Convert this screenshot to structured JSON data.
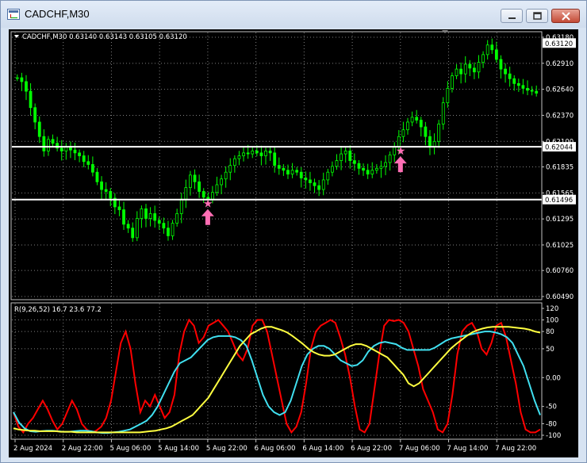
{
  "window": {
    "title": "CADCHF,M30",
    "buttons": [
      "minimize",
      "maximize",
      "close"
    ]
  },
  "colors": {
    "background": "#000000",
    "candles": "#00ff00",
    "level_lines": "#ffffff",
    "signal_marker": "#ff6eb4",
    "rvi_red": "#ff0000",
    "rvi_cyan": "#40e0f0",
    "rvi_yellow": "#ffff40",
    "grid": "#808080"
  },
  "icons": [
    "window-app-icon",
    "minimize-icon",
    "maximize-icon",
    "close-icon",
    "star-marker-icon",
    "arrow-up-icon"
  ],
  "chart_data": [
    {
      "type": "candlestick",
      "header": "CADCHF,M30  0.63140 0.63143 0.63105 0.63120",
      "symbol": "CADCHF",
      "timeframe": "M30",
      "ohlc_current": {
        "open": "0.63140",
        "high": "0.63143",
        "low": "0.63105",
        "close": "0.63120"
      },
      "y_ticks": [
        "0.63180",
        "0.62910",
        "0.62640",
        "0.62370",
        "0.62100",
        "0.61835",
        "0.61565",
        "0.61295",
        "0.61025",
        "0.60760",
        "0.60490"
      ],
      "ylim": [
        0.6049,
        0.6318
      ],
      "price_tag": "0.63120",
      "levels": [
        {
          "value": 0.62044,
          "label": "0.62044"
        },
        {
          "value": 0.61496,
          "label": "0.61496"
        }
      ],
      "closes": [
        0.6276,
        0.6272,
        0.6262,
        0.6245,
        0.623,
        0.6215,
        0.62,
        0.6212,
        0.6208,
        0.6203,
        0.62,
        0.6204,
        0.6201,
        0.6198,
        0.6195,
        0.6189,
        0.6186,
        0.6178,
        0.6168,
        0.616,
        0.6158,
        0.6151,
        0.6142,
        0.6139,
        0.6124,
        0.612,
        0.611,
        0.613,
        0.614,
        0.613,
        0.6135,
        0.6128,
        0.6125,
        0.612,
        0.6112,
        0.6125,
        0.6135,
        0.615,
        0.6162,
        0.6175,
        0.6168,
        0.6158,
        0.6152,
        0.615,
        0.6157,
        0.6165,
        0.6171,
        0.6178,
        0.6185,
        0.6192,
        0.6195,
        0.6198,
        0.6197,
        0.62,
        0.6198,
        0.6195,
        0.62,
        0.6198,
        0.6185,
        0.6182,
        0.618,
        0.6176,
        0.618,
        0.6178,
        0.6172,
        0.617,
        0.6167,
        0.6164,
        0.616,
        0.617,
        0.6178,
        0.6184,
        0.619,
        0.6197,
        0.62,
        0.619,
        0.6187,
        0.6182,
        0.618,
        0.6176,
        0.618,
        0.6182,
        0.6184,
        0.6188,
        0.6196,
        0.6204,
        0.6215,
        0.6222,
        0.623,
        0.6235,
        0.6232,
        0.6225,
        0.6215,
        0.6204,
        0.621,
        0.6228,
        0.625,
        0.6265,
        0.6278,
        0.6285,
        0.628,
        0.629,
        0.6286,
        0.6282,
        0.6292,
        0.63,
        0.631,
        0.6305,
        0.6295,
        0.6285,
        0.628,
        0.6275,
        0.627,
        0.6268,
        0.6265,
        0.6263,
        0.6262,
        0.626
      ],
      "signals": [
        {
          "time": "5 Aug 22:00",
          "type": "buy",
          "price": 0.61496
        },
        {
          "time": "7 Aug 06:00",
          "type": "buy",
          "price": 0.62044
        }
      ]
    },
    {
      "type": "line",
      "header": "R(9,26,52) 16.7 23.6 77.2",
      "indicator": "R(9,26,52)",
      "current_values": [
        "16.7",
        "23.6",
        "77.2"
      ],
      "y_ticks": [
        "120",
        "100",
        "80",
        "50",
        "0.00",
        "-50",
        "-80",
        "-100"
      ],
      "ylim": [
        -100,
        120
      ],
      "x_labels": [
        "2 Aug 2024",
        "2 Aug 22:00",
        "5 Aug 06:00",
        "5 Aug 14:00",
        "5 Aug 22:00",
        "6 Aug 06:00",
        "6 Aug 14:00",
        "6 Aug 22:00",
        "7 Aug 06:00",
        "7 Aug 14:00",
        "7 Aug 22:00"
      ],
      "series": [
        {
          "color": "#ff0000",
          "values": [
            -60,
            -85,
            -95,
            -80,
            -70,
            -55,
            -40,
            -55,
            -75,
            -90,
            -80,
            -60,
            -40,
            -55,
            -80,
            -90,
            -95,
            -92,
            -85,
            -70,
            -40,
            10,
            60,
            80,
            50,
            -10,
            -60,
            -40,
            -50,
            -30,
            -50,
            -70,
            -60,
            -30,
            40,
            80,
            100,
            90,
            60,
            70,
            90,
            95,
            100,
            90,
            80,
            60,
            40,
            30,
            50,
            90,
            100,
            100,
            80,
            40,
            0,
            -40,
            -80,
            -95,
            -85,
            -60,
            -10,
            50,
            80,
            90,
            95,
            100,
            95,
            70,
            40,
            0,
            -50,
            -90,
            -95,
            -80,
            -20,
            40,
            90,
            100,
            98,
            100,
            95,
            80,
            50,
            20,
            -20,
            -40,
            -60,
            -90,
            -95,
            -80,
            -30,
            40,
            80,
            90,
            95,
            80,
            50,
            40,
            60,
            90,
            95,
            70,
            30,
            -10,
            -60,
            -90,
            -95,
            -95,
            -90
          ]
        },
        {
          "color": "#40e0f0",
          "values": [
            -60,
            -78,
            -88,
            -93,
            -94,
            -93,
            -92,
            -92,
            -93,
            -94,
            -94,
            -93,
            -92,
            -92,
            -93,
            -95,
            -96,
            -96,
            -95,
            -94,
            -92,
            -90,
            -85,
            -80,
            -75,
            -65,
            -50,
            -30,
            -10,
            10,
            25,
            30,
            35,
            45,
            55,
            65,
            70,
            72,
            72,
            72,
            70,
            65,
            55,
            30,
            0,
            -30,
            -50,
            -60,
            -65,
            -60,
            -40,
            -10,
            20,
            40,
            50,
            55,
            55,
            50,
            40,
            30,
            25,
            20,
            22,
            30,
            45,
            55,
            60,
            62,
            60,
            58,
            52,
            48,
            48,
            48,
            48,
            48,
            52,
            58,
            64,
            68,
            70,
            72,
            74,
            76,
            78,
            80,
            80,
            78,
            75,
            70,
            60,
            40,
            20,
            -10,
            -40,
            -65
          ]
        },
        {
          "color": "#ffff40",
          "values": [
            -88,
            -90,
            -91,
            -92,
            -92,
            -93,
            -93,
            -93,
            -93,
            -94,
            -94,
            -94,
            -95,
            -95,
            -95,
            -95,
            -95,
            -95,
            -95,
            -95,
            -95,
            -95,
            -95,
            -95,
            -95,
            -94,
            -93,
            -92,
            -90,
            -88,
            -85,
            -80,
            -75,
            -70,
            -65,
            -55,
            -45,
            -35,
            -20,
            -5,
            10,
            25,
            40,
            55,
            65,
            75,
            80,
            85,
            88,
            88,
            85,
            82,
            78,
            72,
            65,
            58,
            50,
            44,
            40,
            38,
            38,
            40,
            45,
            50,
            55,
            58,
            58,
            55,
            50,
            45,
            40,
            35,
            25,
            15,
            5,
            -10,
            -15,
            -10,
            0,
            10,
            20,
            30,
            40,
            50,
            58,
            65,
            72,
            78,
            82,
            85,
            87,
            88,
            88,
            88,
            88,
            87,
            86,
            85,
            83,
            80,
            78
          ]
        }
      ]
    }
  ]
}
